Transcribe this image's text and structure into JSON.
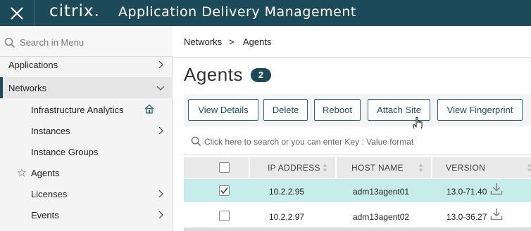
{
  "header": {
    "logo_text": "citrix.",
    "app_title": "Application Delivery Management"
  },
  "sidebar": {
    "search_placeholder": "Search in Menu",
    "items": [
      {
        "label": "Applications"
      },
      {
        "label": "Networks"
      },
      {
        "label": "Infrastructure Analytics"
      },
      {
        "label": "Instances"
      },
      {
        "label": "Instance Groups"
      },
      {
        "label": "Agents"
      },
      {
        "label": "Licenses"
      },
      {
        "label": "Events"
      }
    ]
  },
  "breadcrumb": {
    "parent": "Networks",
    "separator": ">",
    "current": "Agents"
  },
  "page": {
    "title": "Agents",
    "count": "2"
  },
  "toolbar": {
    "view_details": "View Details",
    "delete": "Delete",
    "reboot": "Reboot",
    "attach_site": "Attach Site",
    "view_fingerprint": "View Fingerprint"
  },
  "table": {
    "search_placeholder": "Click here to search or you can enter Key : Value format",
    "columns": [
      "IP ADDRESS",
      "HOST NAME",
      "VERSION"
    ],
    "rows": [
      {
        "selected": true,
        "ip": "10.2.2.95",
        "host": "adm13agent01",
        "version": "13.0-71.40"
      },
      {
        "selected": false,
        "ip": "10.2.2.97",
        "host": "adm13agent02",
        "version": "13.0-36.27"
      }
    ]
  },
  "colors": {
    "brand": "#1c4a59",
    "selected_row": "#c7ecec"
  },
  "icons": [
    "close-icon",
    "search-icon",
    "chevron-right-icon",
    "chevron-down-icon",
    "home-icon",
    "star-icon",
    "sort-icon",
    "download-icon",
    "hand-cursor-icon",
    "checkbox-checked-icon"
  ]
}
